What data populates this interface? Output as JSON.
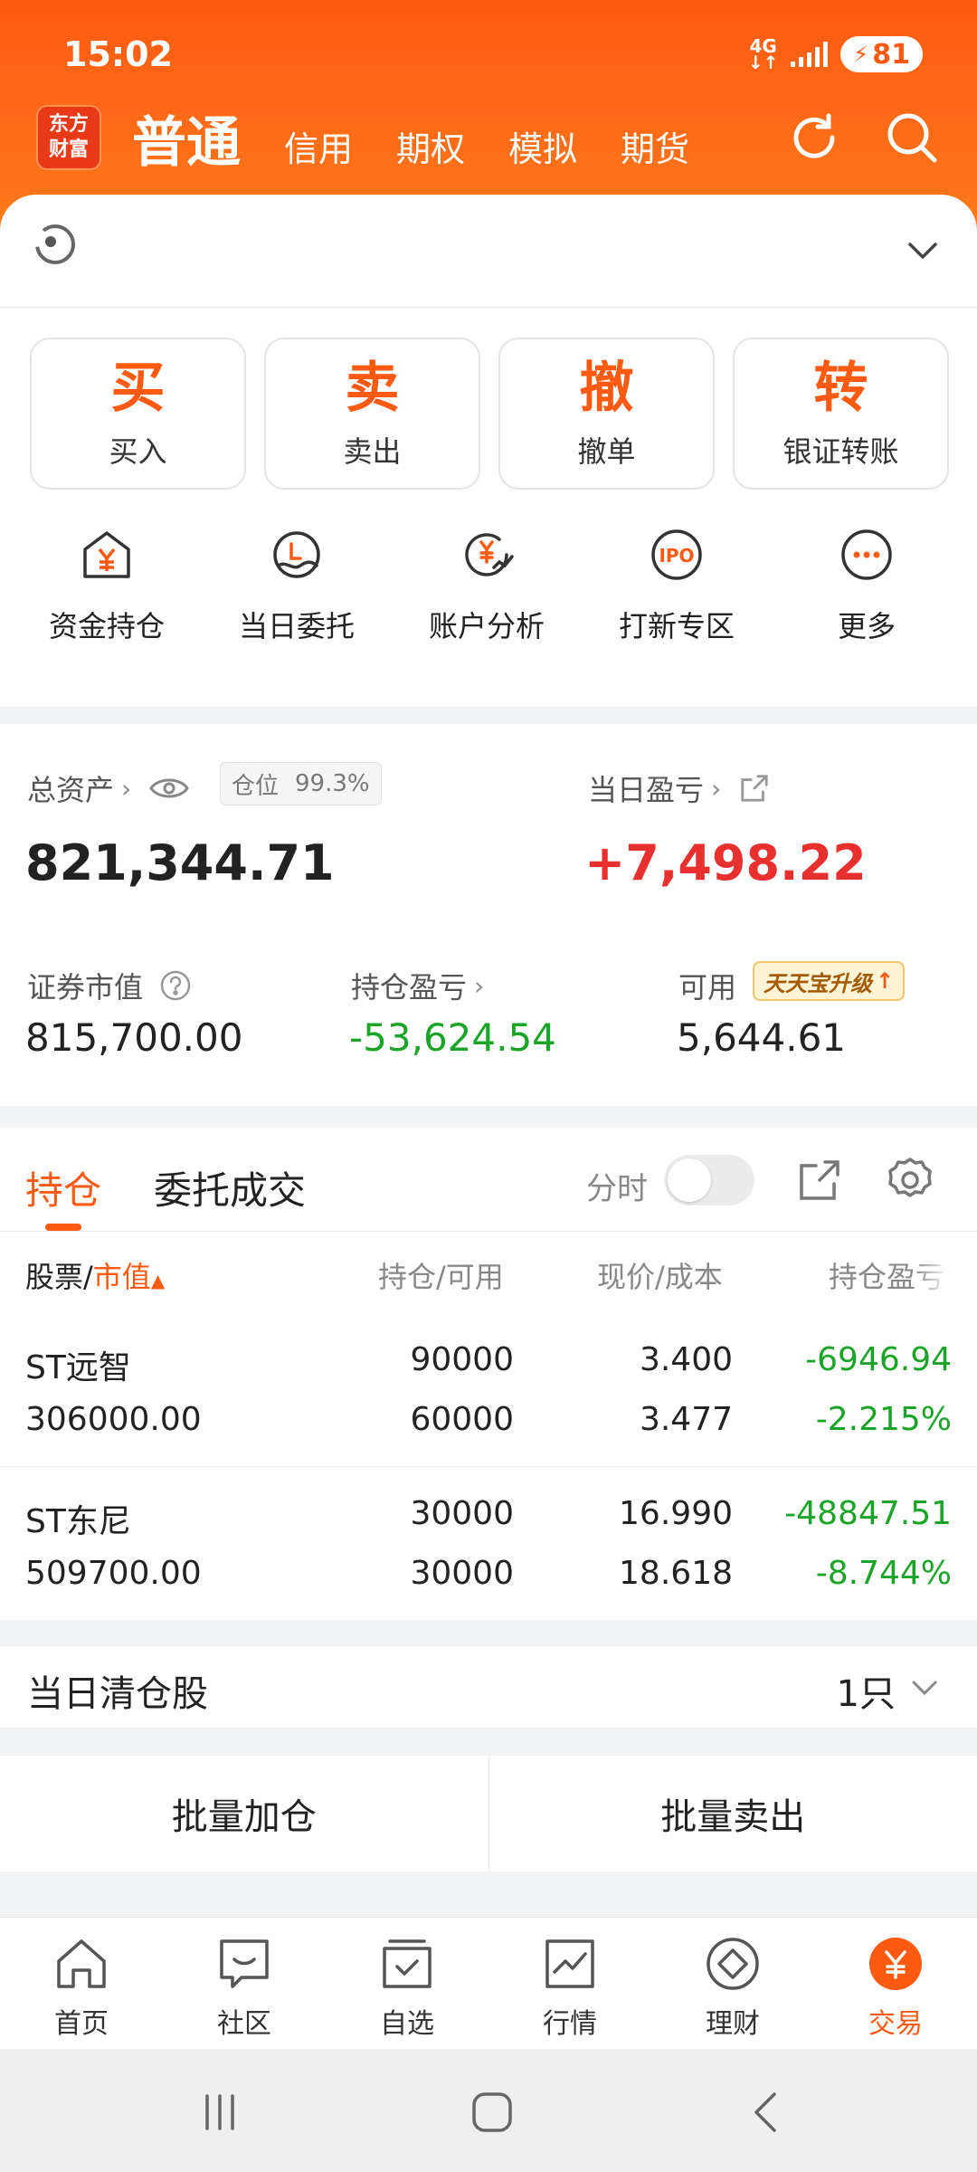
{
  "status_bar": {
    "time": "15:02",
    "network": "4G",
    "battery": "81"
  },
  "header": {
    "logo_text": "东方财富",
    "main_tab": "普通",
    "tabs": [
      "信用",
      "期权",
      "模拟",
      "期货"
    ]
  },
  "actions": {
    "buttons": [
      {
        "big": "买",
        "label": "买入"
      },
      {
        "big": "卖",
        "label": "卖出"
      },
      {
        "big": "撤",
        "label": "撤单"
      },
      {
        "big": "转",
        "label": "银证转账"
      }
    ],
    "icons": [
      {
        "label": "资金持仓",
        "icon": "wallet-yuan-icon"
      },
      {
        "label": "当日委托",
        "icon": "order-icon"
      },
      {
        "label": "账户分析",
        "icon": "analysis-icon"
      },
      {
        "label": "打新专区",
        "icon": "ipo-icon"
      },
      {
        "label": "更多",
        "icon": "more-icon"
      }
    ]
  },
  "assets": {
    "total_label": "总资产",
    "position_label": "仓位",
    "position_value": "99.3%",
    "total_value": "821,344.71",
    "daily_pl_label": "当日盈亏",
    "daily_pl_value": "+7,498.22",
    "market_value_label": "证券市值",
    "market_value": "815,700.00",
    "holding_pl_label": "持仓盈亏",
    "holding_pl": "-53,624.54",
    "available_label": "可用",
    "available_value": "5,644.61",
    "ttb_badge": "天天宝升级"
  },
  "holdings": {
    "tabs": [
      "持仓",
      "委托成交"
    ],
    "fenshi_label": "分时",
    "fenshi_on": false,
    "headers": {
      "stock": "股票/",
      "stock_accent": "市值",
      "position": "持仓/可用",
      "price": "现价/成本",
      "pl": "持仓盈亏"
    },
    "rows": [
      {
        "name": "ST远智",
        "market_value": "306000.00",
        "position": "90000",
        "available": "60000",
        "price": "3.400",
        "cost": "3.477",
        "pl": "-6946.94",
        "pl_pct": "-2.215%"
      },
      {
        "name": "ST东尼",
        "market_value": "509700.00",
        "position": "30000",
        "available": "30000",
        "price": "16.990",
        "cost": "18.618",
        "pl": "-48847.51",
        "pl_pct": "-8.744%"
      }
    ]
  },
  "cleared": {
    "label": "当日清仓股",
    "count": "1只"
  },
  "batch": {
    "add": "批量加仓",
    "sell": "批量卖出"
  },
  "bottom_nav": [
    "首页",
    "社区",
    "自选",
    "行情",
    "理财",
    "交易"
  ],
  "colors": {
    "brand": "#ff5a12",
    "up": "#e8312f",
    "down": "#1ba528"
  }
}
